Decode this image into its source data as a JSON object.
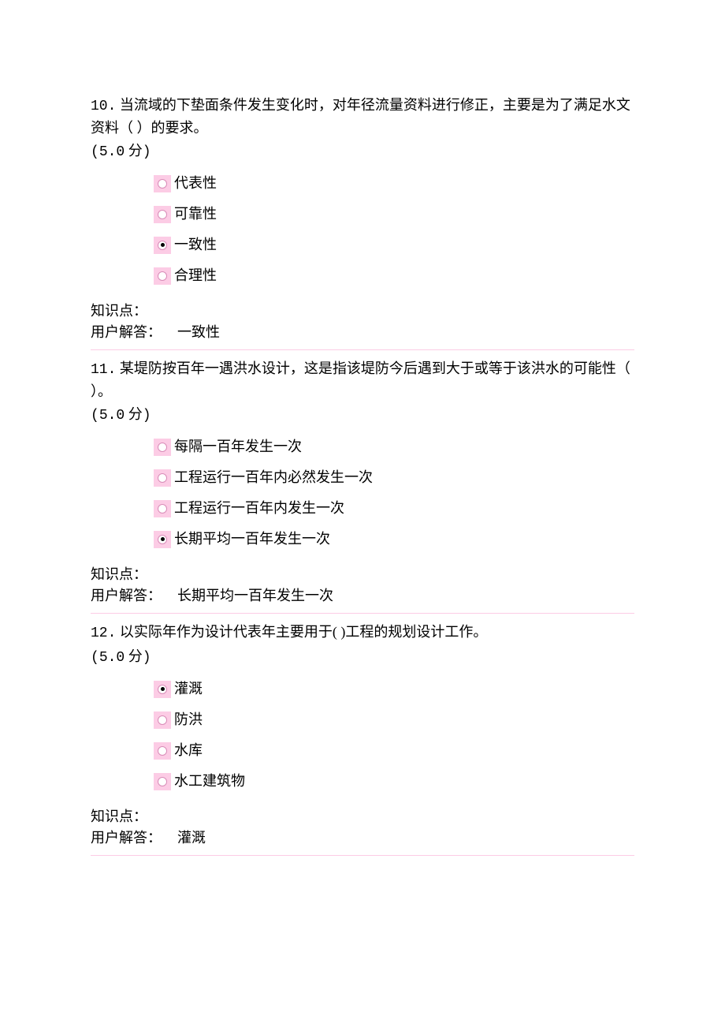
{
  "labels": {
    "knowledge_point": "知识点：",
    "user_answer": "用户解答："
  },
  "questions": [
    {
      "number": "10.",
      "text": "当流域的下垫面条件发生变化时，对年径流量资料进行修正，主要是为了满足水文资料（ ）的要求。",
      "points_prefix": "(",
      "points_value": "5.0",
      "points_unit": " 分",
      "points_suffix": ")",
      "options": [
        {
          "label": "代表性",
          "selected": false
        },
        {
          "label": "可靠性",
          "selected": false
        },
        {
          "label": "一致性",
          "selected": true
        },
        {
          "label": "合理性",
          "selected": false
        }
      ],
      "knowledge_point": "",
      "user_answer": "一致性"
    },
    {
      "number": "11.",
      "text": "某堤防按百年一遇洪水设计，这是指该堤防今后遇到大于或等于该洪水的可能性（ ）。",
      "points_prefix": "(",
      "points_value": "5.0",
      "points_unit": " 分",
      "points_suffix": ")",
      "options": [
        {
          "label": "每隔一百年发生一次",
          "selected": false
        },
        {
          "label": "工程运行一百年内必然发生一次",
          "selected": false
        },
        {
          "label": "工程运行一百年内发生一次",
          "selected": false
        },
        {
          "label": "长期平均一百年发生一次",
          "selected": true
        }
      ],
      "knowledge_point": "",
      "user_answer": "长期平均一百年发生一次"
    },
    {
      "number": "12.",
      "text": "以实际年作为设计代表年主要用于( )工程的规划设计工作。",
      "points_prefix": "(",
      "points_value": "5.0",
      "points_unit": " 分",
      "points_suffix": ")",
      "options": [
        {
          "label": "灌溉",
          "selected": true
        },
        {
          "label": "防洪",
          "selected": false
        },
        {
          "label": "水库",
          "selected": false
        },
        {
          "label": "水工建筑物",
          "selected": false
        }
      ],
      "knowledge_point": "",
      "user_answer": "灌溉"
    }
  ]
}
